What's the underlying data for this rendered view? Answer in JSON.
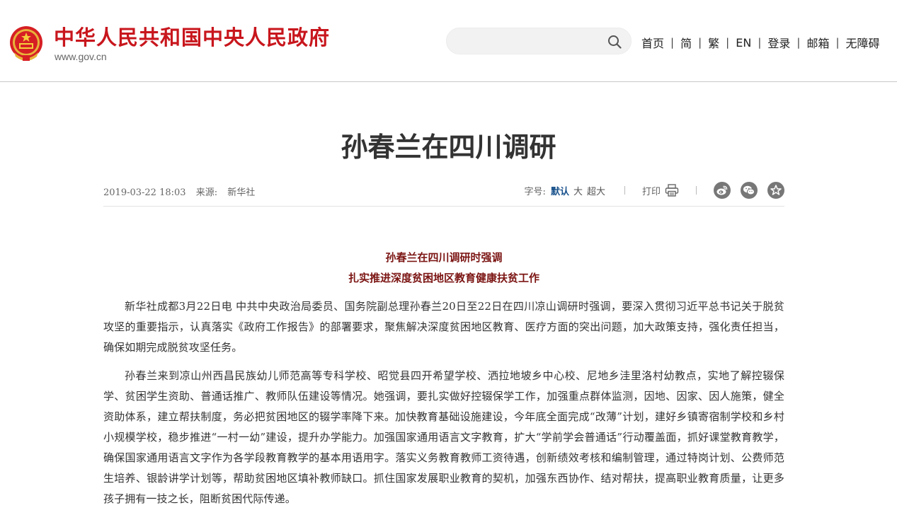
{
  "header": {
    "site_name": "中华人民共和国中央人民政府",
    "site_url": "www.gov.cn",
    "search": {
      "value": "",
      "placeholder": ""
    },
    "nav": [
      {
        "label": "首页"
      },
      {
        "label": "简"
      },
      {
        "label": "繁"
      },
      {
        "label": "EN"
      },
      {
        "label": "登录"
      },
      {
        "label": "邮箱"
      },
      {
        "label": "无障碍"
      }
    ],
    "separator": "|"
  },
  "article": {
    "title": "孙春兰在四川调研",
    "meta": {
      "datetime": "2019-03-22 18:03",
      "source_label": "来源:",
      "source": "新华社",
      "font_size_label": "字号:",
      "font_sizes": [
        "默认",
        "大",
        "超大"
      ],
      "print_label": "打印"
    },
    "share_icons": [
      "weibo-icon",
      "wechat-icon",
      "favorite-icon"
    ],
    "subtitle_lines": [
      "孙春兰在四川调研时强调",
      "扎实推进深度贫困地区教育健康扶贫工作"
    ],
    "paragraphs": [
      "新华社成都3月22日电 中共中央政治局委员、国务院副总理孙春兰20日至22日在四川凉山调研时强调，要深入贯彻习近平总书记关于脱贫攻坚的重要指示，认真落实《政府工作报告》的部署要求，聚焦解决深度贫困地区教育、医疗方面的突出问题，加大政策支持，强化责任担当，确保如期完成脱贫攻坚任务。",
      "孙春兰来到凉山州西昌民族幼儿师范高等专科学校、昭觉县四开希望学校、洒拉地坡乡中心校、尼地乡洼里洛村幼教点，实地了解控辍保学、贫困学生资助、普通话推广、教师队伍建设等情况。她强调，要扎实做好控辍保学工作，加强重点群体监测，因地、因家、因人施策，健全资助体系，建立帮扶制度，务必把贫困地区的辍学率降下来。加快教育基础设施建设，今年底全面完成“改薄”计划，建好乡镇寄宿制学校和乡村小规模学校，稳步推进“一村一幼”建设，提升办学能力。加强国家通用语言文字教育，扩大“学前学会普通话”行动覆盖面，抓好课堂教育教学，确保国家通用语言文字作为各学段教育教学的基本用语用字。落实义务教育教师工资待遇，创新绩效考核和编制管理，通过特岗计划、公费师范生培养、银龄讲学计划等，帮助贫困地区填补教师缺口。抓住国家发展职业教育的契机，加强东西协作、结对帮扶，提高职业教育质量，让更多孩子拥有一技之长，阻断贫困代际传递。"
    ]
  },
  "colors": {
    "brand_red": "#c8161d",
    "subtitle_red": "#7b1513",
    "active_blue": "#16508a"
  }
}
